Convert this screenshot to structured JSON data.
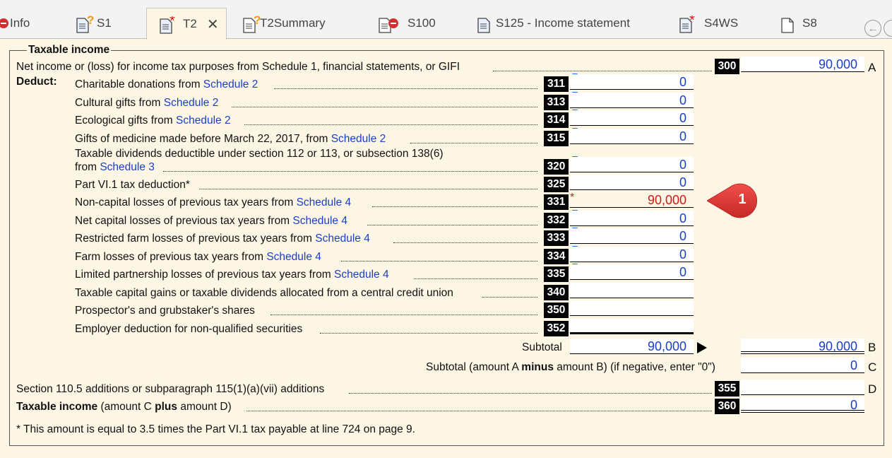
{
  "tabs": [
    {
      "label": "Info",
      "status": "error"
    },
    {
      "label": "S1",
      "status": "question"
    },
    {
      "label": "T2",
      "status": "required",
      "active": true
    },
    {
      "label": "T2Summary",
      "status": "question"
    },
    {
      "label": "S100",
      "status": "error"
    },
    {
      "label": "S125 - Income statement",
      "status": "none"
    },
    {
      "label": "S4WS",
      "status": "required"
    },
    {
      "label": "S8",
      "status": "blank"
    }
  ],
  "tab_close_glyph": "✕",
  "nav_back_glyph": "←",
  "section_title": "Taxable income",
  "line300": {
    "label": "Net income or (loss) for income tax purposes from Schedule 1, financial statements, or GIFI",
    "code": "300",
    "value": "90,000",
    "letter": "A"
  },
  "deduct_label": "Deduct:",
  "deductions": [
    {
      "pre": "Charitable donations from ",
      "link": "Schedule 2",
      "code": "311",
      "value": "0"
    },
    {
      "pre": "Cultural gifts from ",
      "link": "Schedule 2",
      "code": "313",
      "value": "0"
    },
    {
      "pre": "Ecological gifts from ",
      "link": "Schedule 2",
      "code": "314",
      "value": "0"
    },
    {
      "pre": "Gifts of medicine made before March 22, 2017, from ",
      "link": "Schedule 2",
      "code": "315",
      "value": "0"
    },
    {
      "line1": "Taxable dividends deductible under section 112 or 113, or subsection 138(6)",
      "pre": "from ",
      "link": "Schedule 3",
      "code": "320",
      "value": "0"
    },
    {
      "pre": "Part VI.1 tax deduction*",
      "link": "",
      "code": "325",
      "value": "0"
    },
    {
      "pre": "Non-capital losses of previous tax years from ",
      "link": "Schedule 4",
      "code": "331",
      "value": "90,000"
    },
    {
      "pre": "Net capital losses of previous tax years from ",
      "link": "Schedule 4",
      "code": "332",
      "value": "0"
    },
    {
      "pre": "Restricted farm losses of previous tax years from ",
      "link": "Schedule 4",
      "code": "333",
      "value": "0"
    },
    {
      "pre": "Farm losses of previous tax years from ",
      "link": "Schedule 4",
      "code": "334",
      "value": "0"
    },
    {
      "pre": "Limited partnership losses of previous tax years from ",
      "link": "Schedule 4",
      "code": "335",
      "value": "0"
    },
    {
      "pre": "Taxable capital gains or taxable dividends allocated from a central credit union",
      "link": "",
      "code": "340",
      "value": ""
    },
    {
      "pre": "Prospector's and grubstaker's shares",
      "link": "",
      "code": "350",
      "value": ""
    },
    {
      "pre": "Employer deduction for non-qualified securities",
      "link": "",
      "code": "352",
      "value": ""
    }
  ],
  "subtotal": {
    "label": "Subtotal",
    "value": "90,000",
    "right_value": "90,000",
    "letter": "B"
  },
  "subtotal_c": {
    "pre": "Subtotal (amount A ",
    "bold": "minus",
    "post": " amount B) (if negative, enter \"0\")",
    "value": "0",
    "letter": "C"
  },
  "line355": {
    "label": "Section 110.5 additions or subparagraph 115(1)(a)(vii) additions",
    "code": "355",
    "value": "",
    "letter": "D"
  },
  "line360": {
    "bold1": "Taxable income",
    "pre": " (amount C ",
    "bold2": "plus",
    "post": " amount D)",
    "code": "360",
    "value": "0"
  },
  "footnote": "* This amount is equal to 3.5 times the Part VI.1 tax payable at line 724 on page 9.",
  "callout_number": "1",
  "colors": {
    "link": "#1a3ecb",
    "value": "#1a3ecb",
    "error": "#d01a1a",
    "callout": "#e53935",
    "background": "#fdf6e4"
  }
}
